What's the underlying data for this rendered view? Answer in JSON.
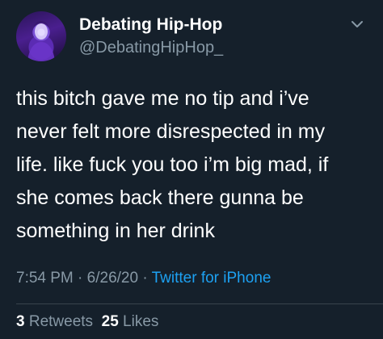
{
  "header": {
    "display_name": "Debating Hip-Hop",
    "handle": "@DebatingHipHop_",
    "avatar_icon": "profile-avatar",
    "menu_icon": "chevron-down-icon"
  },
  "tweet": {
    "lines": [
      "this bitch gave me no tip and i’ve",
      "never felt more disrespected in my",
      "life. like fuck you too i’m big mad, if",
      "she comes back there gunna be",
      "something in her drink"
    ]
  },
  "meta": {
    "time": "7:54 PM",
    "separator": " · ",
    "date": "6/26/20",
    "source": "Twitter for iPhone"
  },
  "stats": {
    "retweets_count": "3",
    "retweets_label": "Retweets",
    "likes_count": "25",
    "likes_label": "Likes"
  },
  "colors": {
    "background": "#15202b",
    "text": "#ffffff",
    "muted": "#8899a6",
    "accent": "#1da1f2",
    "divider": "#38444d"
  }
}
